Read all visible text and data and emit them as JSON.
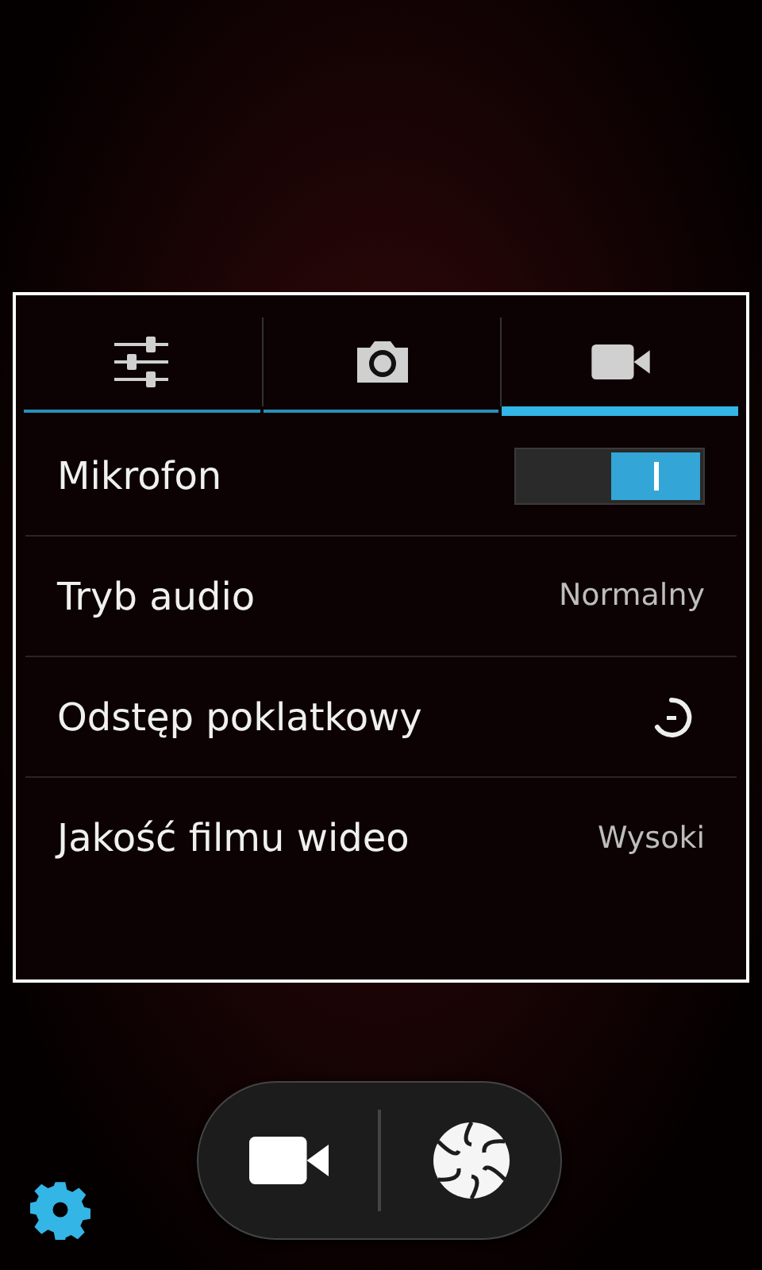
{
  "tabs": [
    {
      "kind": "settings",
      "selected": false
    },
    {
      "kind": "camera",
      "selected": false
    },
    {
      "kind": "video",
      "selected": true
    }
  ],
  "rows": [
    {
      "kind": "switch",
      "label": "Mikrofon",
      "on": true
    },
    {
      "kind": "value",
      "label": "Tryb audio",
      "value": "Normalny"
    },
    {
      "kind": "timer",
      "label": "Odstęp poklatkowy"
    },
    {
      "kind": "value",
      "label": "Jakość filmu wideo",
      "value": "Wysoki"
    }
  ],
  "mode_buttons": [
    {
      "kind": "video"
    },
    {
      "kind": "shutter"
    }
  ]
}
